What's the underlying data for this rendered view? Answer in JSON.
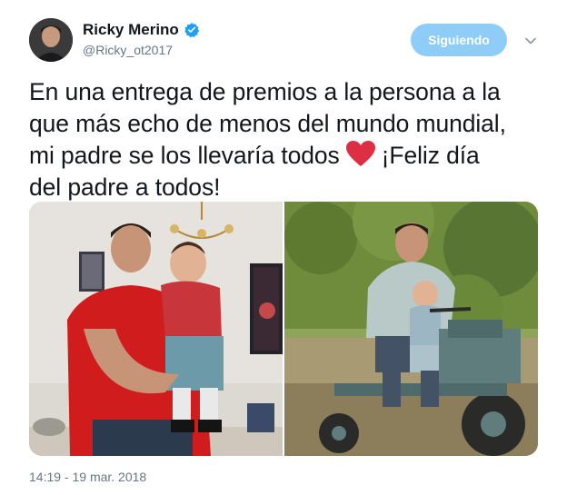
{
  "user": {
    "display_name": "Ricky Merino",
    "handle": "@Ricky_ot2017",
    "verified": true
  },
  "follow_button": {
    "label": "Siguiendo"
  },
  "tweet": {
    "lines": [
      "En una entrega de premios a la persona a la",
      "que más echo de menos del mundo mundial,",
      "mi padre se los llevaría todos",
      "¡Feliz día",
      "del padre a todos!"
    ],
    "emoji": "heavy-heart"
  },
  "media": {
    "photos": [
      {
        "name": "father-holding-baby-photo"
      },
      {
        "name": "father-on-tractor-photo"
      }
    ]
  },
  "timestamp": "14:19 - 19 mar. 2018",
  "colors": {
    "accent": "#1da1f2",
    "follow_button_bg": "#8ecdf8",
    "secondary_text": "#657786",
    "heart": "#e0245e"
  }
}
